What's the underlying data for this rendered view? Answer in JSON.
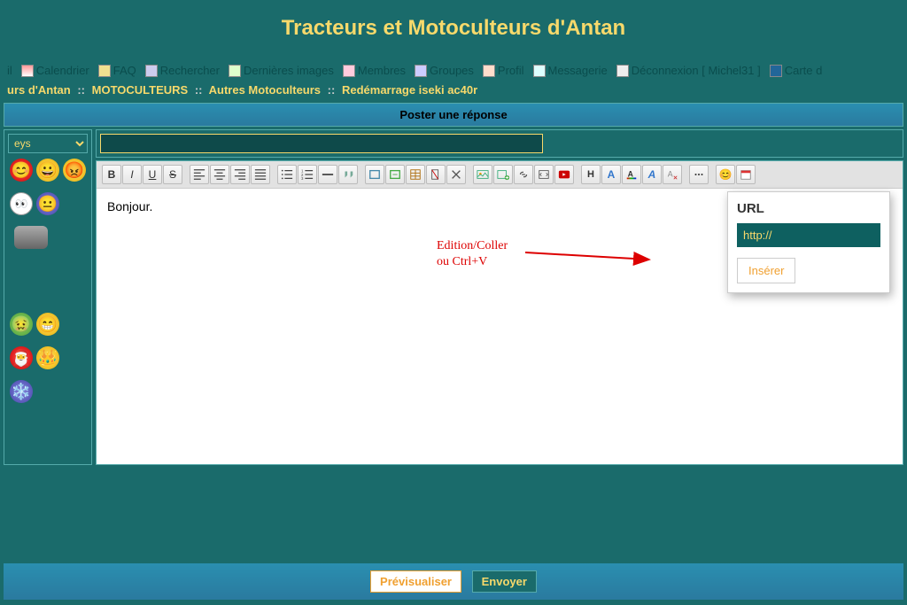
{
  "header": {
    "title": "Tracteurs et Motoculteurs d'Antan"
  },
  "nav": {
    "accueil": "il",
    "calendar": "Calendrier",
    "faq": "FAQ",
    "search": "Rechercher",
    "images": "Dernières images",
    "members": "Membres",
    "groups": "Groupes",
    "profile": "Profil",
    "messaging": "Messagerie",
    "logout": "Déconnexion [ Michel31 ]",
    "map": "Carte d"
  },
  "breadcrumb": {
    "p1": "urs d'Antan",
    "p2": "MOTOCULTEURS",
    "p3": "Autres Motoculteurs",
    "p4": "Redémarrage iseki ac40r",
    "sep": "::"
  },
  "post": {
    "header": "Poster une réponse",
    "subject_value": "",
    "body_text": "Bonjour."
  },
  "sidebar": {
    "select_label": "eys"
  },
  "urlpopup": {
    "label": "URL",
    "value": "http://",
    "insert": "Insérer"
  },
  "annotation": {
    "line1": "Edition/Coller",
    "line2": "ou Ctrl+V"
  },
  "footer": {
    "preview": "Prévisualiser",
    "send": "Envoyer"
  }
}
